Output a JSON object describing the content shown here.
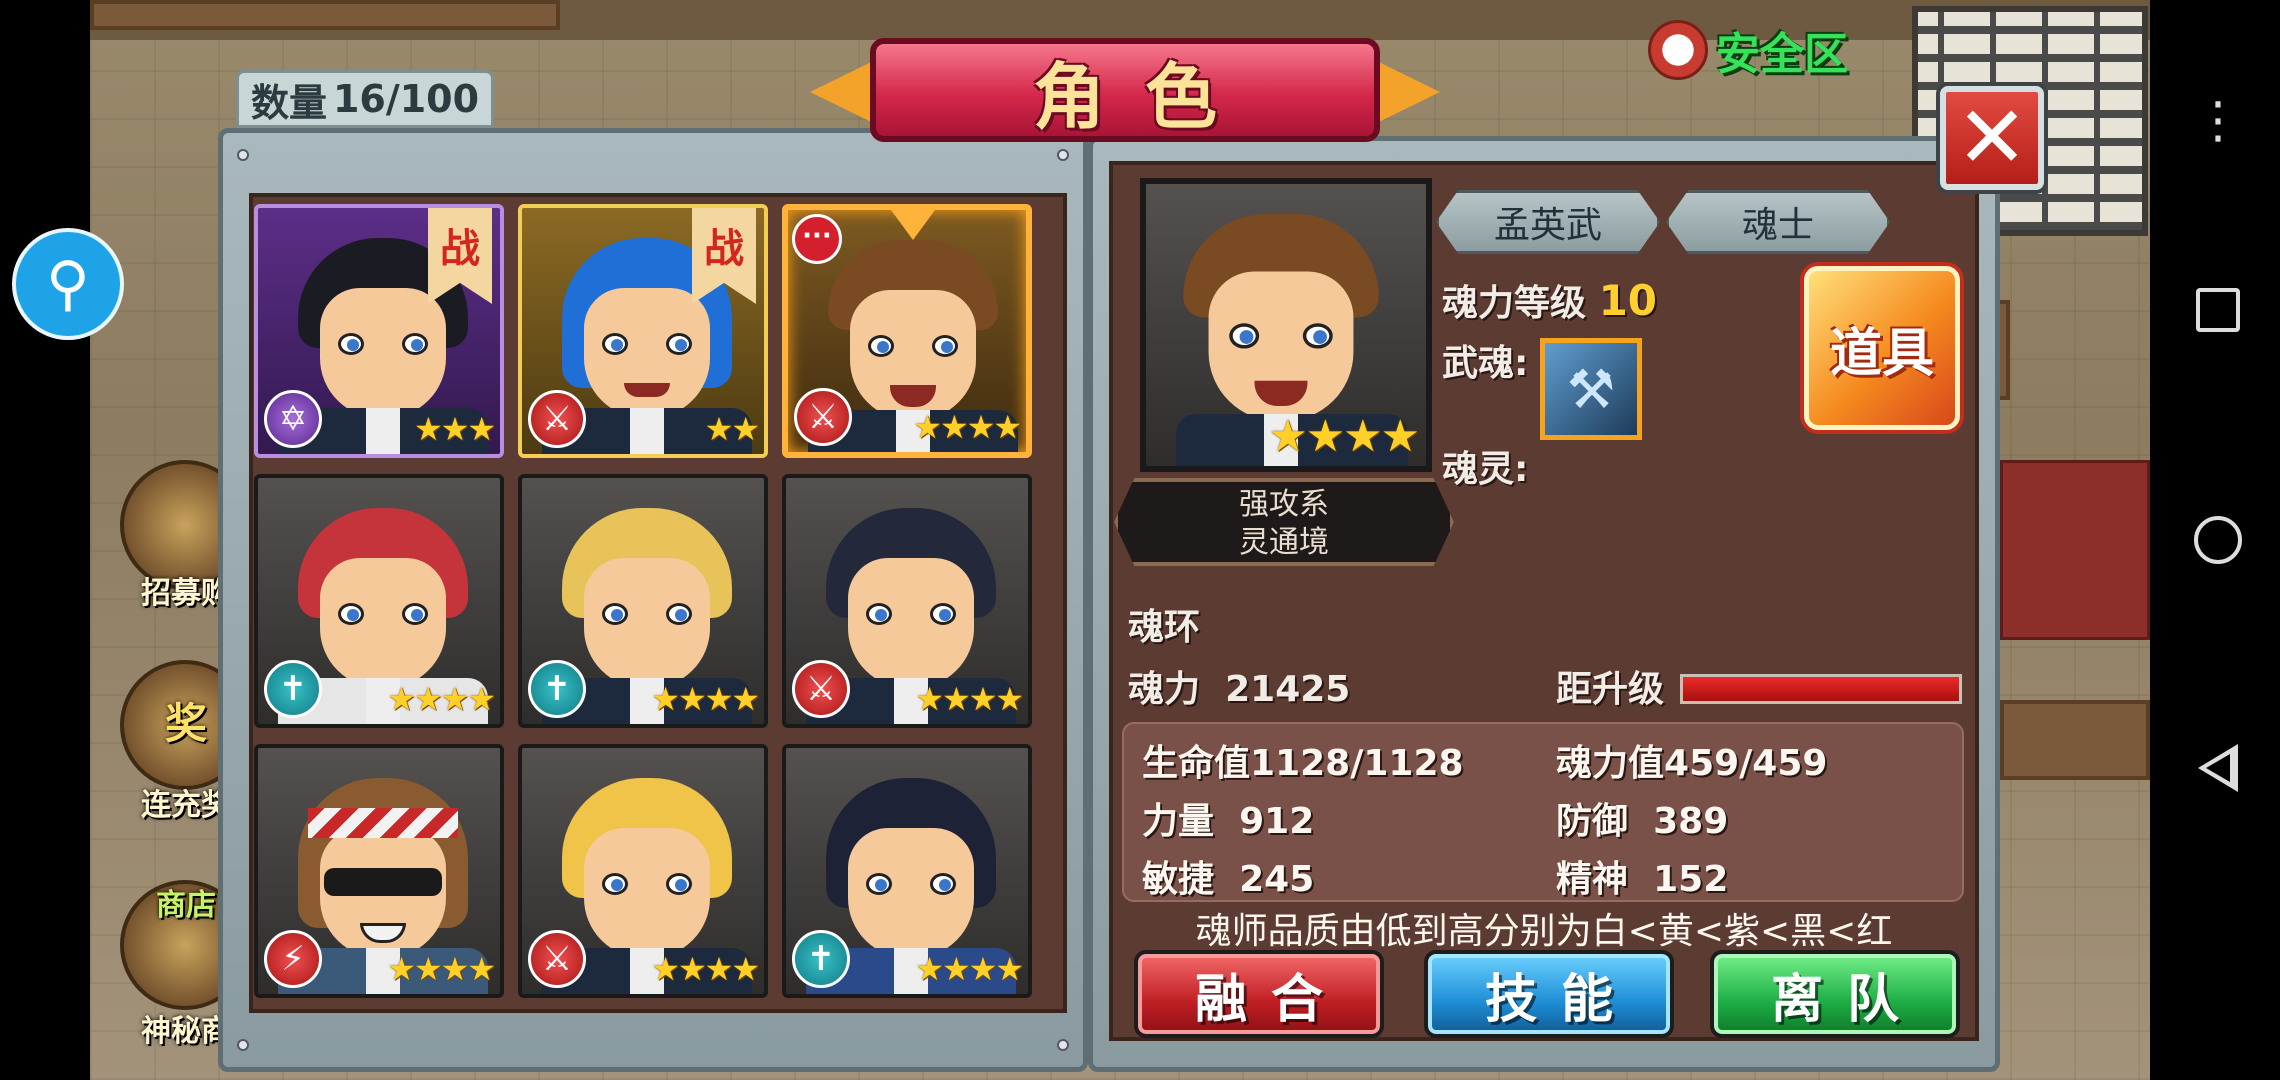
{
  "header": {
    "title": "角色",
    "count_label": "数量",
    "count_value": "16/100",
    "safe_zone": "安全区"
  },
  "sidebar": {
    "recruit": "招募购",
    "reward_badge": "奖",
    "recharge": "连充奖",
    "shop": "商店",
    "mystery": "神秘商"
  },
  "characters": [
    {
      "stars": "★★★",
      "type_icon": "star-of-david-icon",
      "type_glyph": "✡",
      "battle": "战",
      "frame": "purple"
    },
    {
      "stars": "★★",
      "type_icon": "sword-icon",
      "type_glyph": "⚔",
      "battle": "战",
      "frame": "gold"
    },
    {
      "stars": "★★★★",
      "type_icon": "sword-icon",
      "type_glyph": "⚔",
      "more": "···",
      "frame": "selected"
    },
    {
      "stars": "★★★★",
      "type_icon": "cross-icon",
      "type_glyph": "✝",
      "frame": "grey"
    },
    {
      "stars": "★★★★",
      "type_icon": "cross-icon",
      "type_glyph": "✝",
      "frame": "grey"
    },
    {
      "stars": "★★★★",
      "type_icon": "sword-icon",
      "type_glyph": "⚔",
      "frame": "grey"
    },
    {
      "stars": "★★★★",
      "type_icon": "lightning-icon",
      "type_glyph": "⚡",
      "frame": "grey"
    },
    {
      "stars": "★★★★",
      "type_icon": "sword-icon",
      "type_glyph": "⚔",
      "frame": "grey"
    },
    {
      "stars": "★★★★",
      "type_icon": "cross-icon",
      "type_glyph": "✝",
      "frame": "grey"
    }
  ],
  "detail": {
    "name": "孟英武",
    "title": "魂士",
    "portrait_stars": "★★★★",
    "class_line1": "强攻系",
    "class_line2": "灵通境",
    "level_label": "魂力等级",
    "level_value": "10",
    "weapon_label": "武魂:",
    "spirit_label": "魂灵:",
    "item_button": "道具",
    "soul_ring_label": "魂环",
    "power_label": "魂力",
    "power_value": "21425",
    "upgrade_label": "距升级",
    "upgrade_progress": 1.0,
    "stats": {
      "hp_label": "生命值",
      "hp_value": "1128/1128",
      "mp_label": "魂力值",
      "mp_value": "459/459",
      "str_label": "力量",
      "str_value": "912",
      "def_label": "防御",
      "def_value": "389",
      "agi_label": "敏捷",
      "agi_value": "245",
      "spi_label": "精神",
      "spi_value": "152"
    },
    "hint": "魂师品质由低到高分别为白<黄<紫<黑<红"
  },
  "actions": {
    "fuse": "融合",
    "skill": "技能",
    "leave": "离队"
  },
  "colors": {
    "accent_red": "#d4284a",
    "stat_text": "#fbf6ef",
    "level_yellow": "#ffcf2f",
    "safe_green": "#36e25a"
  }
}
